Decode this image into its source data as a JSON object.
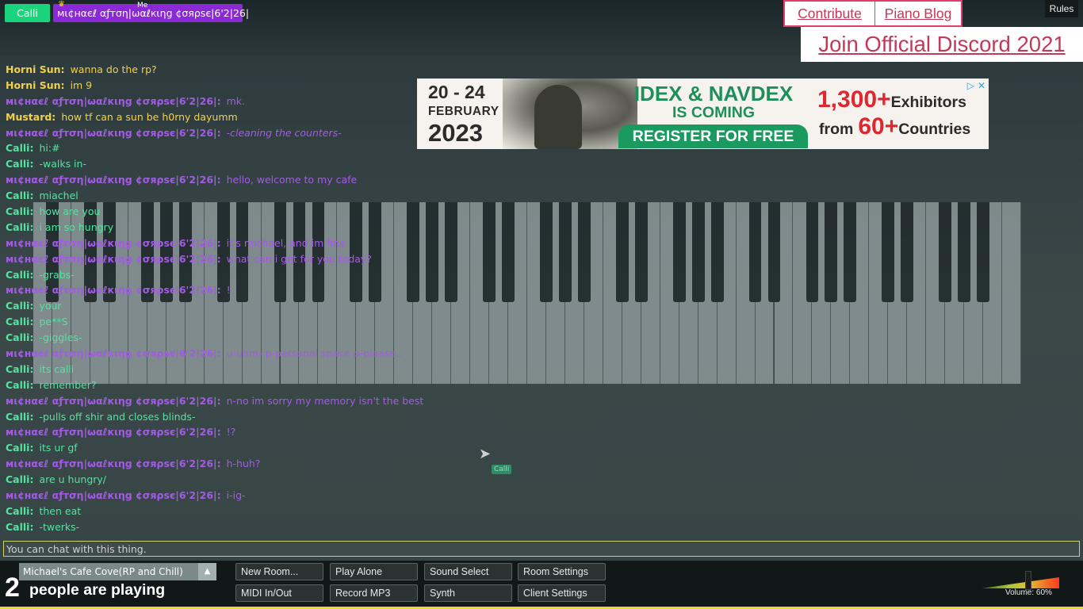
{
  "users": {
    "calli": {
      "name": "Calli",
      "color": "#19d47c"
    },
    "michael": {
      "name": "мι¢нαєℓ αƒтση|ωαℓкιηg ¢σяρѕє|6'2|26|",
      "color": "#8c29d6"
    },
    "me_label": "Me",
    "crown": "♛"
  },
  "links": {
    "contribute": "Contribute",
    "piano_blog": "Piano Blog",
    "discord": "Join Official Discord 2021"
  },
  "rules_button": "Rules",
  "ad": {
    "dates_line1": "20 - 24",
    "dates_line2": "FEBRUARY",
    "dates_line3": "2023",
    "headline_line1": "IDEX & NAVDEX",
    "headline_line2": "IS COMING",
    "cta": "REGISTER FOR FREE",
    "stat1_number": "1,300+",
    "stat1_text": "Exhibitors",
    "stat2_prefix": "from",
    "stat2_number": "60+",
    "stat2_text": "Countries",
    "choice_icon": "▷",
    "close_icon": "✕"
  },
  "chat": {
    "messages": [
      {
        "name": "Horni Sun:",
        "text": "wanna do the rp?",
        "color_class": "c-horni"
      },
      {
        "name": "Horni Sun:",
        "text": "im 9",
        "color_class": "c-horni"
      },
      {
        "name": "мι¢нαєℓ αƒтση|ωαℓкιηg ¢σяρѕє|6'2|26|:",
        "text": "mk.",
        "color_class": "c-mic"
      },
      {
        "name": "Mustard:",
        "text": "how tf can a sun be h0rny dayumm",
        "color_class": "c-mustard"
      },
      {
        "name": "мι¢нαєℓ αƒтση|ωαℓкιηg ¢σяρѕє|6'2|26|:",
        "text": "-cleaning the counters-",
        "color_class": "c-mic",
        "italic": true
      },
      {
        "name": "Calli:",
        "text": "hi:#",
        "color_class": "c-calli"
      },
      {
        "name": "Calli:",
        "text": "-walks in-",
        "color_class": "c-calli"
      },
      {
        "name": "мι¢нαєℓ αƒтση|ωαℓкιηg ¢σяρѕє|6'2|26|:",
        "text": "hello, welcome to my cafe",
        "color_class": "c-mic"
      },
      {
        "name": "Calli:",
        "text": "miachel",
        "color_class": "c-calli"
      },
      {
        "name": "Calli:",
        "text": "how are you",
        "color_class": "c-calli"
      },
      {
        "name": "Calli:",
        "text": "i am so hungry",
        "color_class": "c-calli"
      },
      {
        "name": "мι¢нαєℓ αƒтση|ωαℓкιηg ¢σяρѕє|6'2|26|:",
        "text": "it's michael, and im fine",
        "color_class": "c-mic"
      },
      {
        "name": "мι¢нαєℓ αƒтση|ωαℓкιηg ¢σяρѕє|6'2|26|:",
        "text": "what can i get for you today?",
        "color_class": "c-mic"
      },
      {
        "name": "Calli:",
        "text": "-grabs-",
        "color_class": "c-calli"
      },
      {
        "name": "мι¢нαєℓ αƒтση|ωαℓкιηg ¢σяρѕє|6'2|26|:",
        "text": "!",
        "color_class": "c-mic"
      },
      {
        "name": "Calli:",
        "text": "your",
        "color_class": "c-calli"
      },
      {
        "name": "Calli:",
        "text": "pe**S",
        "color_class": "c-calli"
      },
      {
        "name": "Calli:",
        "text": "-giggles-",
        "color_class": "c-calli"
      },
      {
        "name": "мι¢нαєℓ αƒтση|ωαℓкιηg ¢σяρѕє|6'2|26|:",
        "text": "u-uhm- p-personal space p-please..",
        "color_class": "c-mic"
      },
      {
        "name": "Calli:",
        "text": "its calli",
        "color_class": "c-calli"
      },
      {
        "name": "Calli:",
        "text": "remember?",
        "color_class": "c-calli"
      },
      {
        "name": "мι¢нαєℓ αƒтση|ωαℓкιηg ¢σяρѕє|6'2|26|:",
        "text": "n-no im sorry my memory isn't the best",
        "color_class": "c-mic"
      },
      {
        "name": "Calli:",
        "text": "-pulls off shir and closes blinds-",
        "color_class": "c-calli"
      },
      {
        "name": "мι¢нαєℓ αƒтση|ωαℓкιηg ¢σяρѕє|6'2|26|:",
        "text": "!?",
        "color_class": "c-mic"
      },
      {
        "name": "Calli:",
        "text": "its ur gf",
        "color_class": "c-calli"
      },
      {
        "name": "мι¢нαєℓ αƒтση|ωαℓкιηg ¢σяρѕє|6'2|26|:",
        "text": "h-huh?",
        "color_class": "c-mic"
      },
      {
        "name": "Calli:",
        "text": "are u hungry/",
        "color_class": "c-calli"
      },
      {
        "name": "мι¢нαєℓ αƒтση|ωαℓкιηg ¢σяρѕє|6'2|26|:",
        "text": "i-ig-",
        "color_class": "c-mic"
      },
      {
        "name": "Calli:",
        "text": "then eat",
        "color_class": "c-calli"
      },
      {
        "name": "Calli:",
        "text": "-twerks-",
        "color_class": "c-calli"
      }
    ],
    "input_placeholder": "You can chat with this thing.",
    "cursor_label": "Calli"
  },
  "bottom": {
    "room_name": "Michael's Cafe Cove(RP and Chill)",
    "room_arrow_icon": "▲",
    "people_count": "2",
    "people_label": "people are playing",
    "buttons": {
      "new_room": "New Room...",
      "play_alone": "Play Alone",
      "sound_select": "Sound Select",
      "room_settings": "Room Settings",
      "midi": "MIDI In/Out",
      "record_mp3": "Record MP3",
      "synth": "Synth",
      "client_settings": "Client Settings"
    },
    "volume_label": "Volume: 60%",
    "volume_level": 0.6
  },
  "piano": {
    "white_keys": 52
  }
}
